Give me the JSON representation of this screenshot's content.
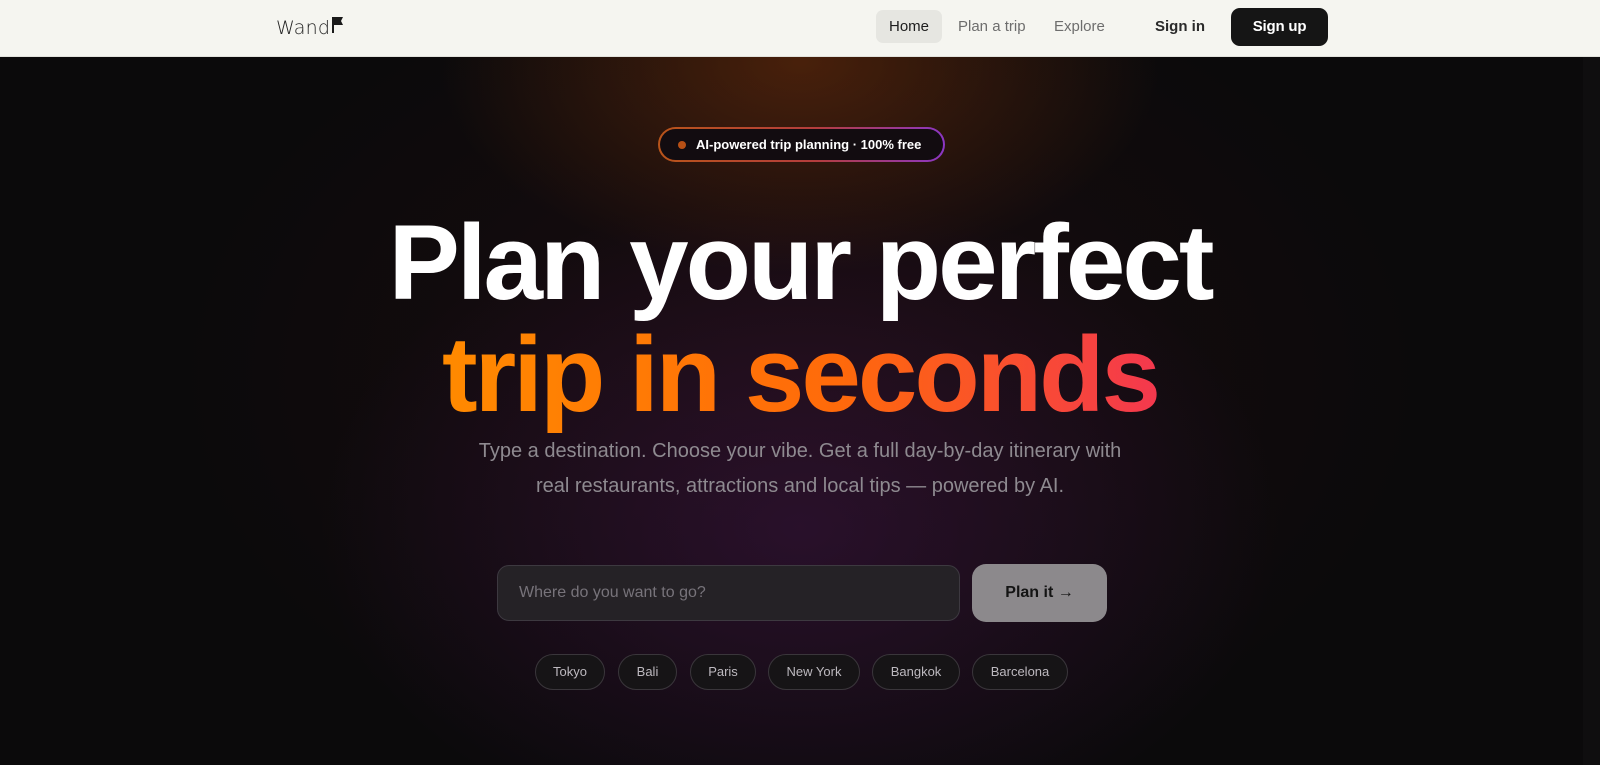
{
  "nav": {
    "logo": "Wand",
    "links": [
      {
        "label": "Home",
        "active": true
      },
      {
        "label": "Plan a trip",
        "active": false
      },
      {
        "label": "Explore",
        "active": false
      }
    ],
    "signin": "Sign in",
    "signup": "Sign up"
  },
  "hero": {
    "badge": "AI-powered trip planning · 100% free",
    "headline_line1": "Plan your perfect",
    "headline_line2": "trip in seconds",
    "subtitle_line1": "Type a destination. Choose your vibe. Get a full day-by-day itinerary with",
    "subtitle_line2": "real restaurants, attractions and local tips — powered by AI.",
    "search_placeholder": "Where do you want to go?",
    "cta": "Plan it →",
    "destinations": [
      "Tokyo",
      "Bali",
      "Paris",
      "New York",
      "Bangkok",
      "Barcelona"
    ]
  },
  "colors": {
    "accent_orange": "#ff8a00",
    "accent_red": "#f4384e",
    "accent_purple": "#8b36c4",
    "nav_bg": "#f5f5f0",
    "hero_bg": "#0b0a0b"
  },
  "icons": [
    "flag-icon",
    "status-dot-icon"
  ]
}
